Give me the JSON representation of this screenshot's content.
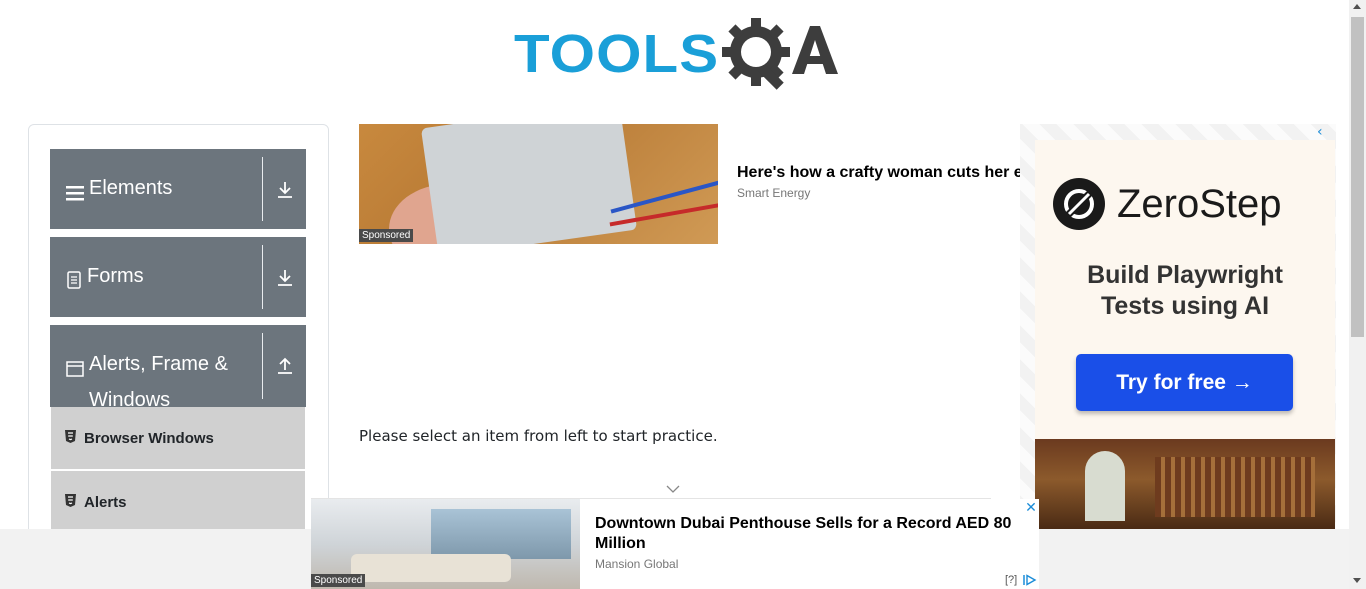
{
  "header": {
    "logo_text_tools": "TOOLS",
    "logo_text_qa": "QA"
  },
  "sidebar": {
    "groups": [
      {
        "label": "Elements",
        "icon": "hamburger-icon",
        "toggle": "download-arrow-icon"
      },
      {
        "label": "Forms",
        "icon": "document-icon",
        "toggle": "download-arrow-icon"
      },
      {
        "label": "Alerts, Frame &",
        "label_line2": "Windows",
        "icon": "window-icon",
        "toggle": "upload-arrow-icon"
      }
    ],
    "items": [
      {
        "label": "Browser Windows",
        "icon": "html5-icon"
      },
      {
        "label": "Alerts",
        "icon": "html5-icon"
      }
    ]
  },
  "main": {
    "practice_text": "Please select an item from left to start practice."
  },
  "ad_top": {
    "title": "Here's how a crafty woman cuts her e",
    "source": "Smart Energy",
    "sponsored": "Sponsored"
  },
  "ad_right": {
    "brand": "ZeroStep",
    "tagline_line1": "Build Playwright",
    "tagline_line2": "Tests using AI",
    "cta": "Try for free →",
    "close": "✕",
    "chevron": "‹"
  },
  "ad_bottom": {
    "title": "Downtown Dubai Penthouse Sells for a Record AED 80 Million",
    "source": "Mansion Global",
    "sponsored": "Sponsored",
    "help": "[?]",
    "close": "✕"
  },
  "colors": {
    "logo_blue": "#1a9fd8",
    "logo_dark": "#3d3d3d",
    "sidebar_group": "#6c757d",
    "sidebar_item": "#d0d0d0",
    "cta_blue": "#1a4fe8"
  }
}
